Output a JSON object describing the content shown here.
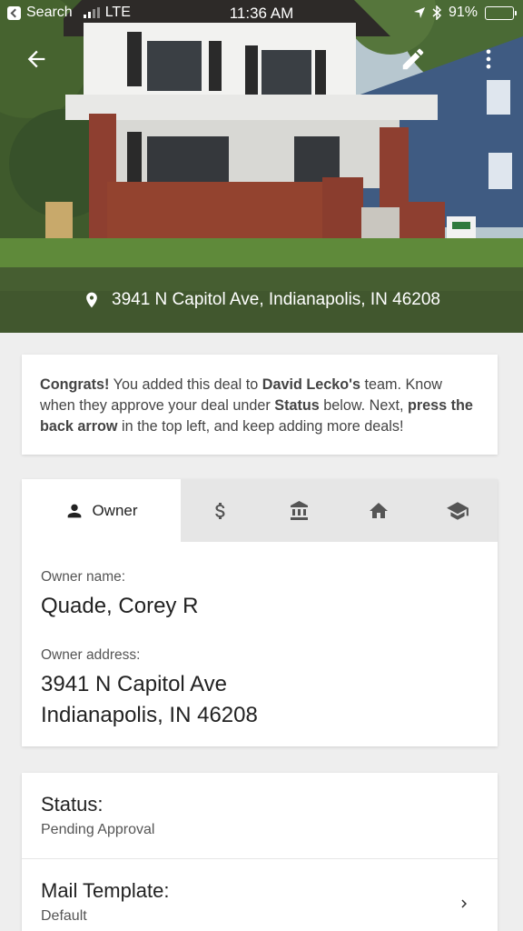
{
  "status_bar": {
    "carrier_back": "Search",
    "network": "LTE",
    "time": "11:36 AM",
    "battery_percent": "91%",
    "battery_level": 0.91
  },
  "hero": {
    "address": "3941 N Capitol Ave, Indianapolis, IN 46208",
    "back_icon": "arrow-left-icon",
    "edit_icon": "pencil-icon",
    "more_icon": "more-vertical-icon"
  },
  "congrats": {
    "lead": "Congrats!",
    "t1": " You added this deal to ",
    "team": "David Lecko's",
    "t2": " team. Know when they approve your deal under ",
    "status_word": "Status",
    "t3": " below. Next, ",
    "press": "press the back arrow",
    "t4": " in the top left, and keep adding more deals!"
  },
  "tabs": {
    "active_label": "Owner",
    "icons": [
      "person-icon",
      "dollar-icon",
      "bank-icon",
      "home-icon",
      "school-icon"
    ]
  },
  "owner": {
    "name_label": "Owner name:",
    "name": "Quade, Corey R",
    "address_label": "Owner address:",
    "address_line1": "3941 N Capitol Ave",
    "address_line2": "Indianapolis, IN 46208"
  },
  "details": {
    "status_title": "Status:",
    "status_value": "Pending Approval",
    "mail_title": "Mail Template:",
    "mail_value": "Default"
  },
  "colors": {
    "icon_dark": "#555555",
    "tab_bg": "#e6e6e6",
    "page_bg": "#eeeeee"
  }
}
